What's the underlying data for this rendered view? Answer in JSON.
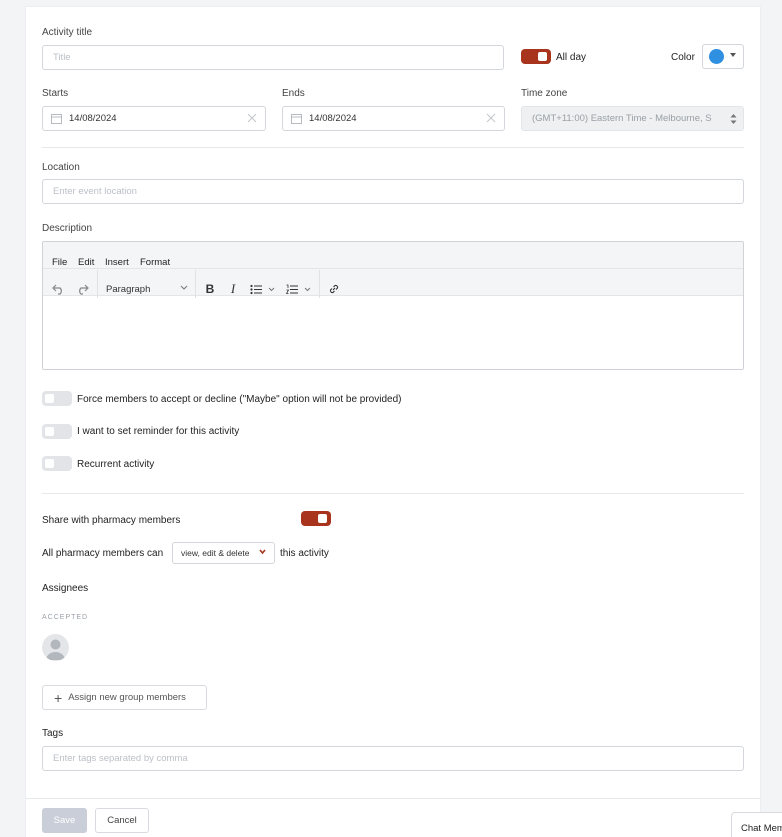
{
  "form": {
    "activity_title_label": "Activity title",
    "title_placeholder": "Title",
    "all_day_label": "All day",
    "color_label": "Color",
    "color_value": "#2f8fe0",
    "starts_label": "Starts",
    "starts_value": "14/08/2024",
    "ends_label": "Ends",
    "ends_value": "14/08/2024",
    "timezone_label": "Time zone",
    "timezone_value": "(GMT+11:00) Eastern Time - Melbourne, S",
    "location_label": "Location",
    "location_placeholder": "Enter event location",
    "description_label": "Description"
  },
  "editor": {
    "menu": [
      "File",
      "Edit",
      "Insert",
      "Format"
    ],
    "block_format": "Paragraph"
  },
  "options": {
    "force_members": "Force members to accept or decline (\"Maybe\" option will not be provided)",
    "reminder": "I want to set reminder for this activity",
    "recurrent": "Recurrent activity"
  },
  "sharing": {
    "share_label": "Share with pharmacy members",
    "members_can_prefix": "All pharmacy members can",
    "permission_value": "view, edit & delete",
    "members_can_suffix": "this activity"
  },
  "assignees": {
    "label": "Assignees",
    "accepted_label": "ACCEPTED",
    "assign_button": "Assign new group members"
  },
  "tags": {
    "label": "Tags",
    "placeholder": "Enter tags separated by comma"
  },
  "footer": {
    "save": "Save",
    "cancel": "Cancel"
  },
  "chat": {
    "label": "Chat Mem"
  },
  "colors": {
    "accent": "#a8341d",
    "save_disabled": "#c9ced8"
  }
}
